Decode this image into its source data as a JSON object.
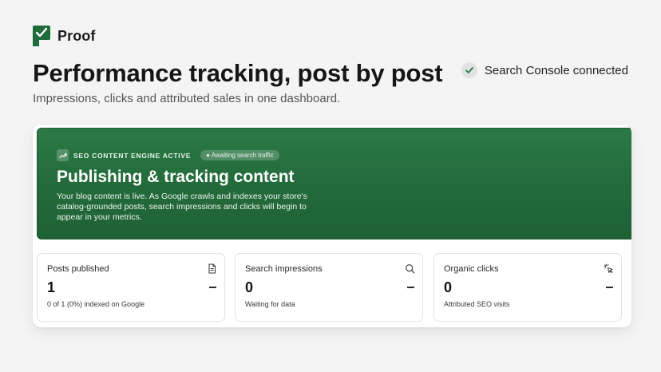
{
  "brand": {
    "name": "Proof",
    "color": "#1f6b3a"
  },
  "header": {
    "title": "Performance tracking, post by post",
    "subtitle": "Impressions, clicks and attributed sales in one dashboard.",
    "connection_status": "Search Console connected"
  },
  "banner": {
    "engine_label": "SEO CONTENT ENGINE ACTIVE",
    "traffic_pill": "Awaiting search traffic",
    "title": "Publishing & tracking content",
    "description": "Your blog content is live. As Google crawls and indexes your store's catalog-grounded posts, search impressions and clicks will begin to appear in your metrics.",
    "background_color": "#236b3b"
  },
  "stats": [
    {
      "label": "Posts published",
      "value": "1",
      "sub": "0 of 1 (0%) indexed on Google",
      "icon": "document-icon",
      "delta": "—"
    },
    {
      "label": "Search impressions",
      "value": "0",
      "sub": "Waiting for data",
      "icon": "search-icon",
      "delta": "—"
    },
    {
      "label": "Organic clicks",
      "value": "0",
      "sub": "Attributed SEO visits",
      "icon": "cursor-click-icon",
      "delta": "—"
    }
  ]
}
